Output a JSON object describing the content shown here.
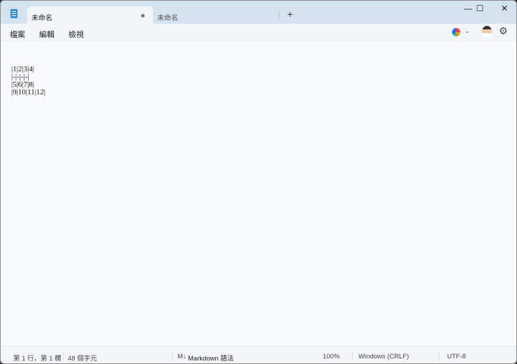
{
  "tabs": [
    {
      "label": "未命名",
      "modified": true
    },
    {
      "label": "未命名"
    }
  ],
  "window_controls": {
    "minimize": "—",
    "maximize": "☐",
    "close": "✕"
  },
  "menu": [
    "檔案",
    "編輯",
    "檢視"
  ],
  "editor": {
    "lines": [
      "|1|2|3|4|",
      "|-|-|-|-|",
      "|5|6|7|8|",
      "|9|10|11|12|"
    ]
  },
  "status": {
    "position": "第 1 行，第 1 欄",
    "chars": "48 個字元",
    "markdown_icon": "M↓",
    "markdown": "Markdown 語法",
    "zoom": "100%",
    "line_ending": "Windows (CRLF)",
    "encoding": "UTF-8"
  }
}
